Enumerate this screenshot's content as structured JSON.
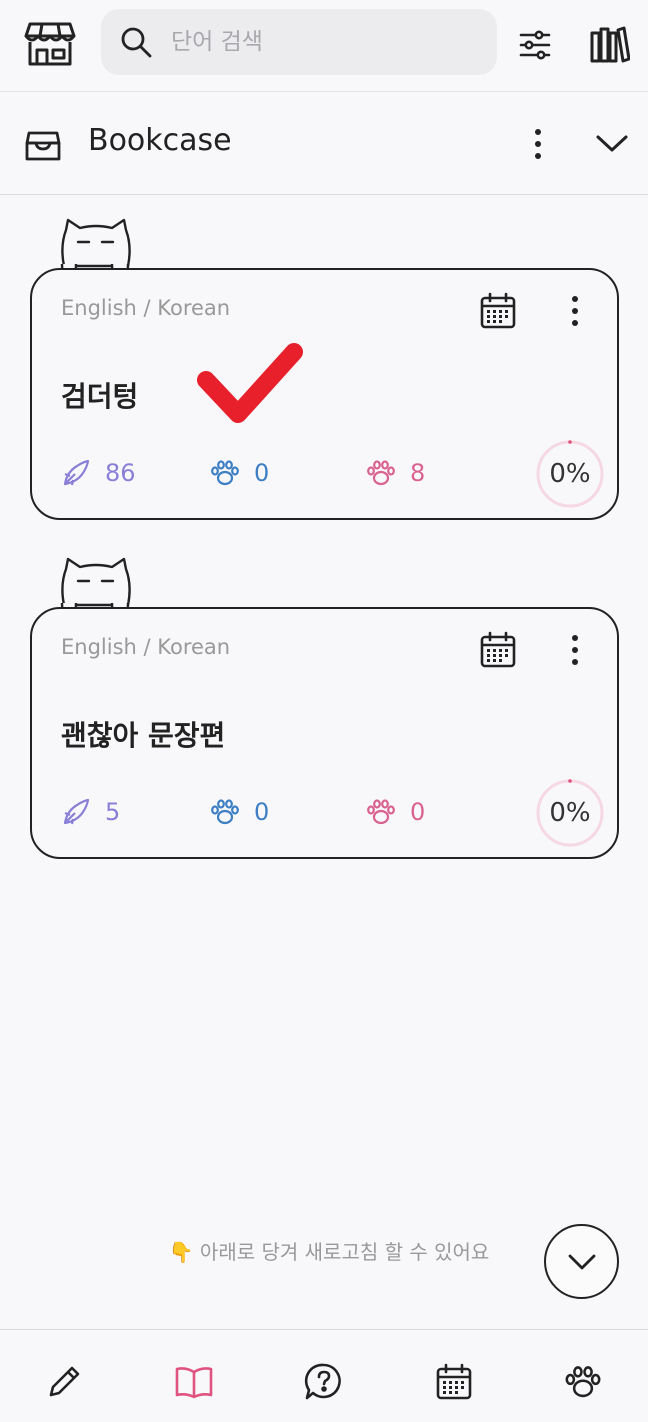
{
  "search": {
    "placeholder": "단어 검색"
  },
  "section": {
    "title": "Bookcase"
  },
  "decks": [
    {
      "language": "English / Korean",
      "title": "검더텅",
      "fish_count": "86",
      "blue_paw_count": "0",
      "pink_paw_count": "8",
      "progress": "0%",
      "progress_fraction": 0
    },
    {
      "language": "English / Korean",
      "title": "괜찮아 문장편",
      "fish_count": "5",
      "blue_paw_count": "0",
      "pink_paw_count": "0",
      "progress": "0%",
      "progress_fraction": 0
    }
  ],
  "hint": {
    "text": "👇 아래로 당겨 새로고침 할 수 있어요"
  },
  "colors": {
    "fish": "#8a7fd6",
    "blue_paw": "#3e7fc4",
    "pink_paw": "#d9628f",
    "accent": "#e0527f",
    "check": "#e8202c"
  },
  "icons": {
    "top": [
      "store-icon",
      "search-icon",
      "filter-sliders-icon",
      "bookshelf-icon"
    ],
    "section": [
      "archive-box-icon",
      "more-vertical-icon",
      "chevron-down-icon"
    ],
    "bottom_nav": [
      "pencil-icon",
      "open-book-icon",
      "question-chat-icon",
      "calendar-icon",
      "paw-icon"
    ]
  }
}
